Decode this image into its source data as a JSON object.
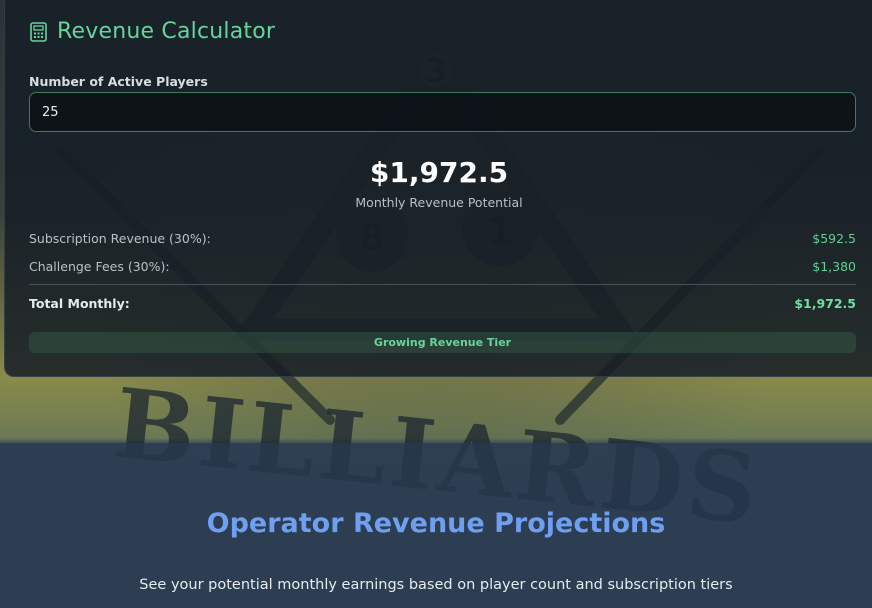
{
  "calculator": {
    "title": "Revenue Calculator",
    "icon": "calculator-icon",
    "players_label": "Number of Active Players",
    "players_value": "25",
    "total_value": "$1,972.5",
    "total_caption": "Monthly Revenue Potential",
    "breakdown": [
      {
        "label": "Subscription Revenue (30%):",
        "value": "$592.5"
      },
      {
        "label": "Challenge Fees (30%):",
        "value": "$1,380"
      }
    ],
    "total_row": {
      "label": "Total Monthly:",
      "value": "$1,972.5"
    },
    "tier": "Growing Revenue Tier"
  },
  "section": {
    "title": "Operator Revenue Projections",
    "subtitle": "See your potential monthly earnings based on player count and subscription tiers"
  },
  "background": {
    "word": "BILLIARDS",
    "balls": [
      "3",
      "8",
      "1"
    ]
  },
  "colors": {
    "accent_green": "#67d49a",
    "value_green": "#5fd191",
    "heading_blue": "#6f9ff0"
  }
}
